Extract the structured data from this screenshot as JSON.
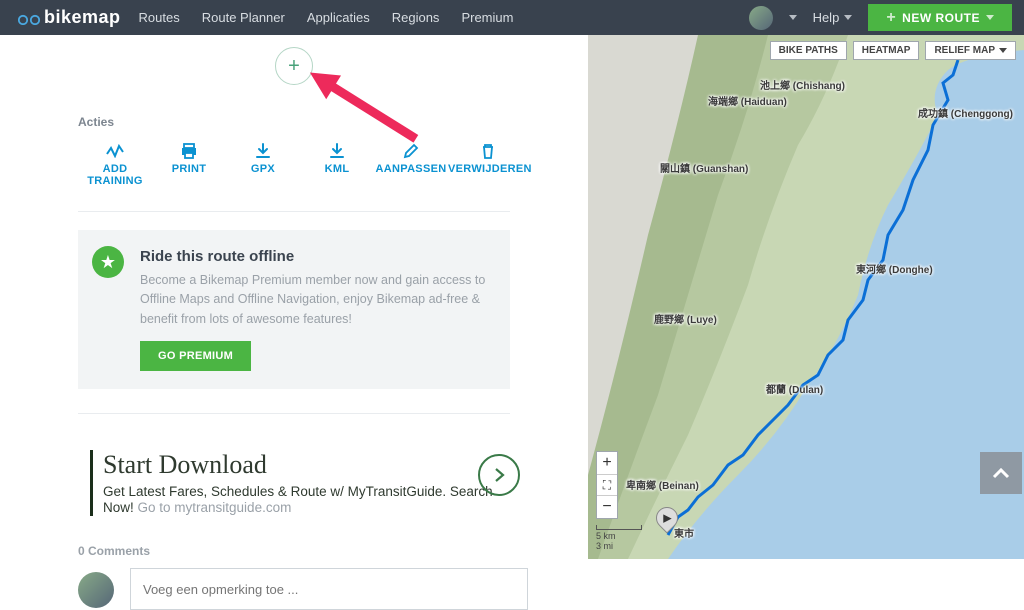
{
  "brand": "bikemap",
  "nav": {
    "routes": "Routes",
    "planner": "Route Planner",
    "apps": "Applicaties",
    "regions": "Regions",
    "premium": "Premium"
  },
  "topbar": {
    "help": "Help",
    "new_route": "NEW ROUTE"
  },
  "actions": {
    "heading": "Acties",
    "add_training": "ADD TRAINING",
    "print": "PRINT",
    "gpx": "GPX",
    "kml": "KML",
    "edit": "AANPASSEN",
    "delete": "VERWIJDEREN"
  },
  "promo": {
    "title": "Ride this route offline",
    "body": "Become a Bikemap Premium member now and gain access to Offline Maps and Offline Navigation, enjoy Bikemap ad-free & benefit from lots of awesome features!",
    "cta": "GO PREMIUM"
  },
  "ad": {
    "title": "Start Download",
    "body_main": "Get Latest Fares, Schedules & Route w/ MyTransitGuide. Search Now! ",
    "body_site": "Go to mytransitguide.com"
  },
  "comments": {
    "heading": "0 Comments",
    "placeholder": "Voeg een opmerking toe ..."
  },
  "map": {
    "layers": {
      "bike": "BIKE PATHS",
      "heat": "HEATMAP",
      "relief": "RELIEF MAP"
    },
    "scale_km": "5 km",
    "scale_mi": "3 mi",
    "labels": {
      "chishang": "池上鄉 (Chishang)",
      "haiduan": "海端鄉 (Haiduan)",
      "chenggong": "成功鎮 (Chenggong)",
      "guanshan": "關山鎮 (Guanshan)",
      "donghe": "東河鄉 (Donghe)",
      "luye": "鹿野鄉 (Luye)",
      "dulan": "都蘭 (Dulan)",
      "beinan": "卑南鄉 (Beinan)",
      "taitung": "東市"
    }
  }
}
